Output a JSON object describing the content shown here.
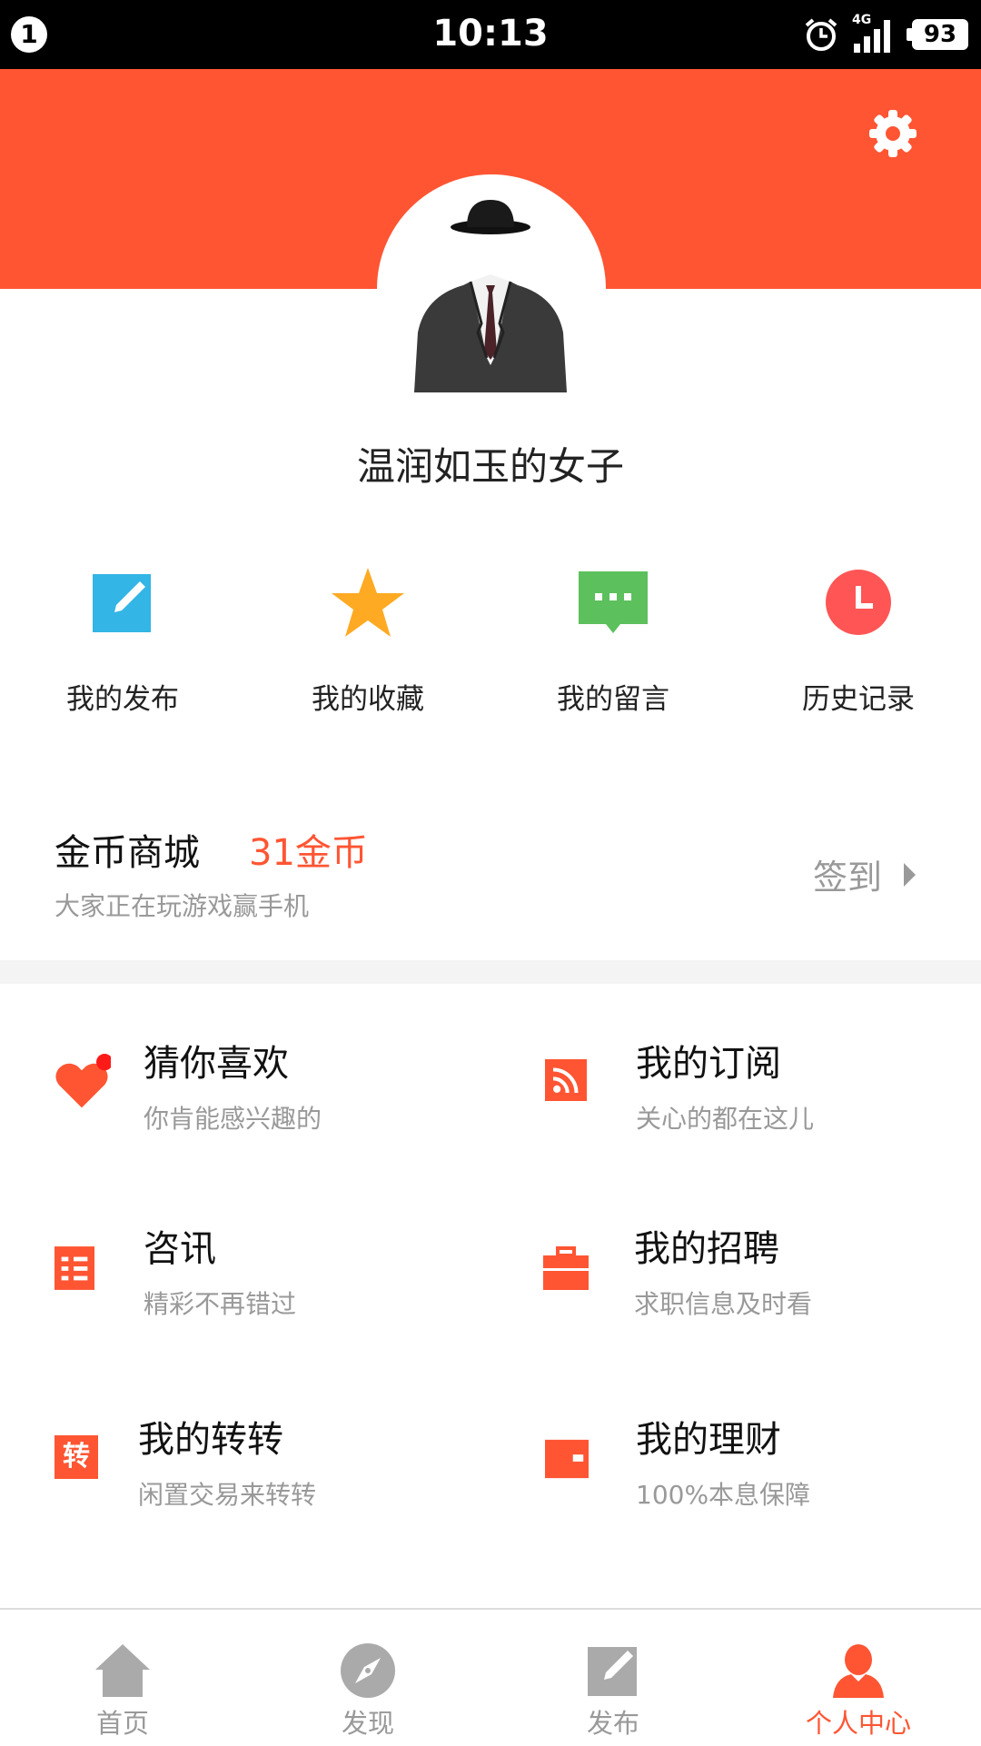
{
  "status_bar": {
    "notification_count": "1",
    "time": "10:13",
    "network": "4G",
    "battery": "93"
  },
  "profile": {
    "username": "温润如玉的女子"
  },
  "quick_actions": [
    {
      "label": "我的发布",
      "icon": "edit-icon",
      "color": "#33b5e5"
    },
    {
      "label": "我的收藏",
      "icon": "star-icon",
      "color": "#ffaa22"
    },
    {
      "label": "我的留言",
      "icon": "message-icon",
      "color": "#5cc05c"
    },
    {
      "label": "历史记录",
      "icon": "clock-icon",
      "color": "#ff5555"
    }
  ],
  "coin_mall": {
    "title": "金币商城",
    "coins": "31金币",
    "subtitle": "大家正在玩游戏赢手机",
    "signin_label": "签到"
  },
  "menu": [
    {
      "title": "猜你喜欢",
      "subtitle": "你肯能感兴趣的",
      "icon": "heart-icon"
    },
    {
      "title": "我的订阅",
      "subtitle": "关心的都在这儿",
      "icon": "rss-icon"
    },
    {
      "title": "咨讯",
      "subtitle": "精彩不再错过",
      "icon": "news-icon"
    },
    {
      "title": "我的招聘",
      "subtitle": "求职信息及时看",
      "icon": "briefcase-icon"
    },
    {
      "title": "我的转转",
      "subtitle": "闲置交易来转转",
      "icon": "zhuan-icon",
      "icon_text": "转"
    },
    {
      "title": "我的理财",
      "subtitle": "100%本息保障",
      "icon": "wallet-icon"
    }
  ],
  "bottom_nav": [
    {
      "label": "首页",
      "icon": "home-icon",
      "active": false
    },
    {
      "label": "发现",
      "icon": "compass-icon",
      "active": false
    },
    {
      "label": "发布",
      "icon": "publish-icon",
      "active": false
    },
    {
      "label": "个人中心",
      "icon": "person-icon",
      "active": true
    }
  ],
  "colors": {
    "accent": "#ff5533",
    "muted": "#999999"
  }
}
